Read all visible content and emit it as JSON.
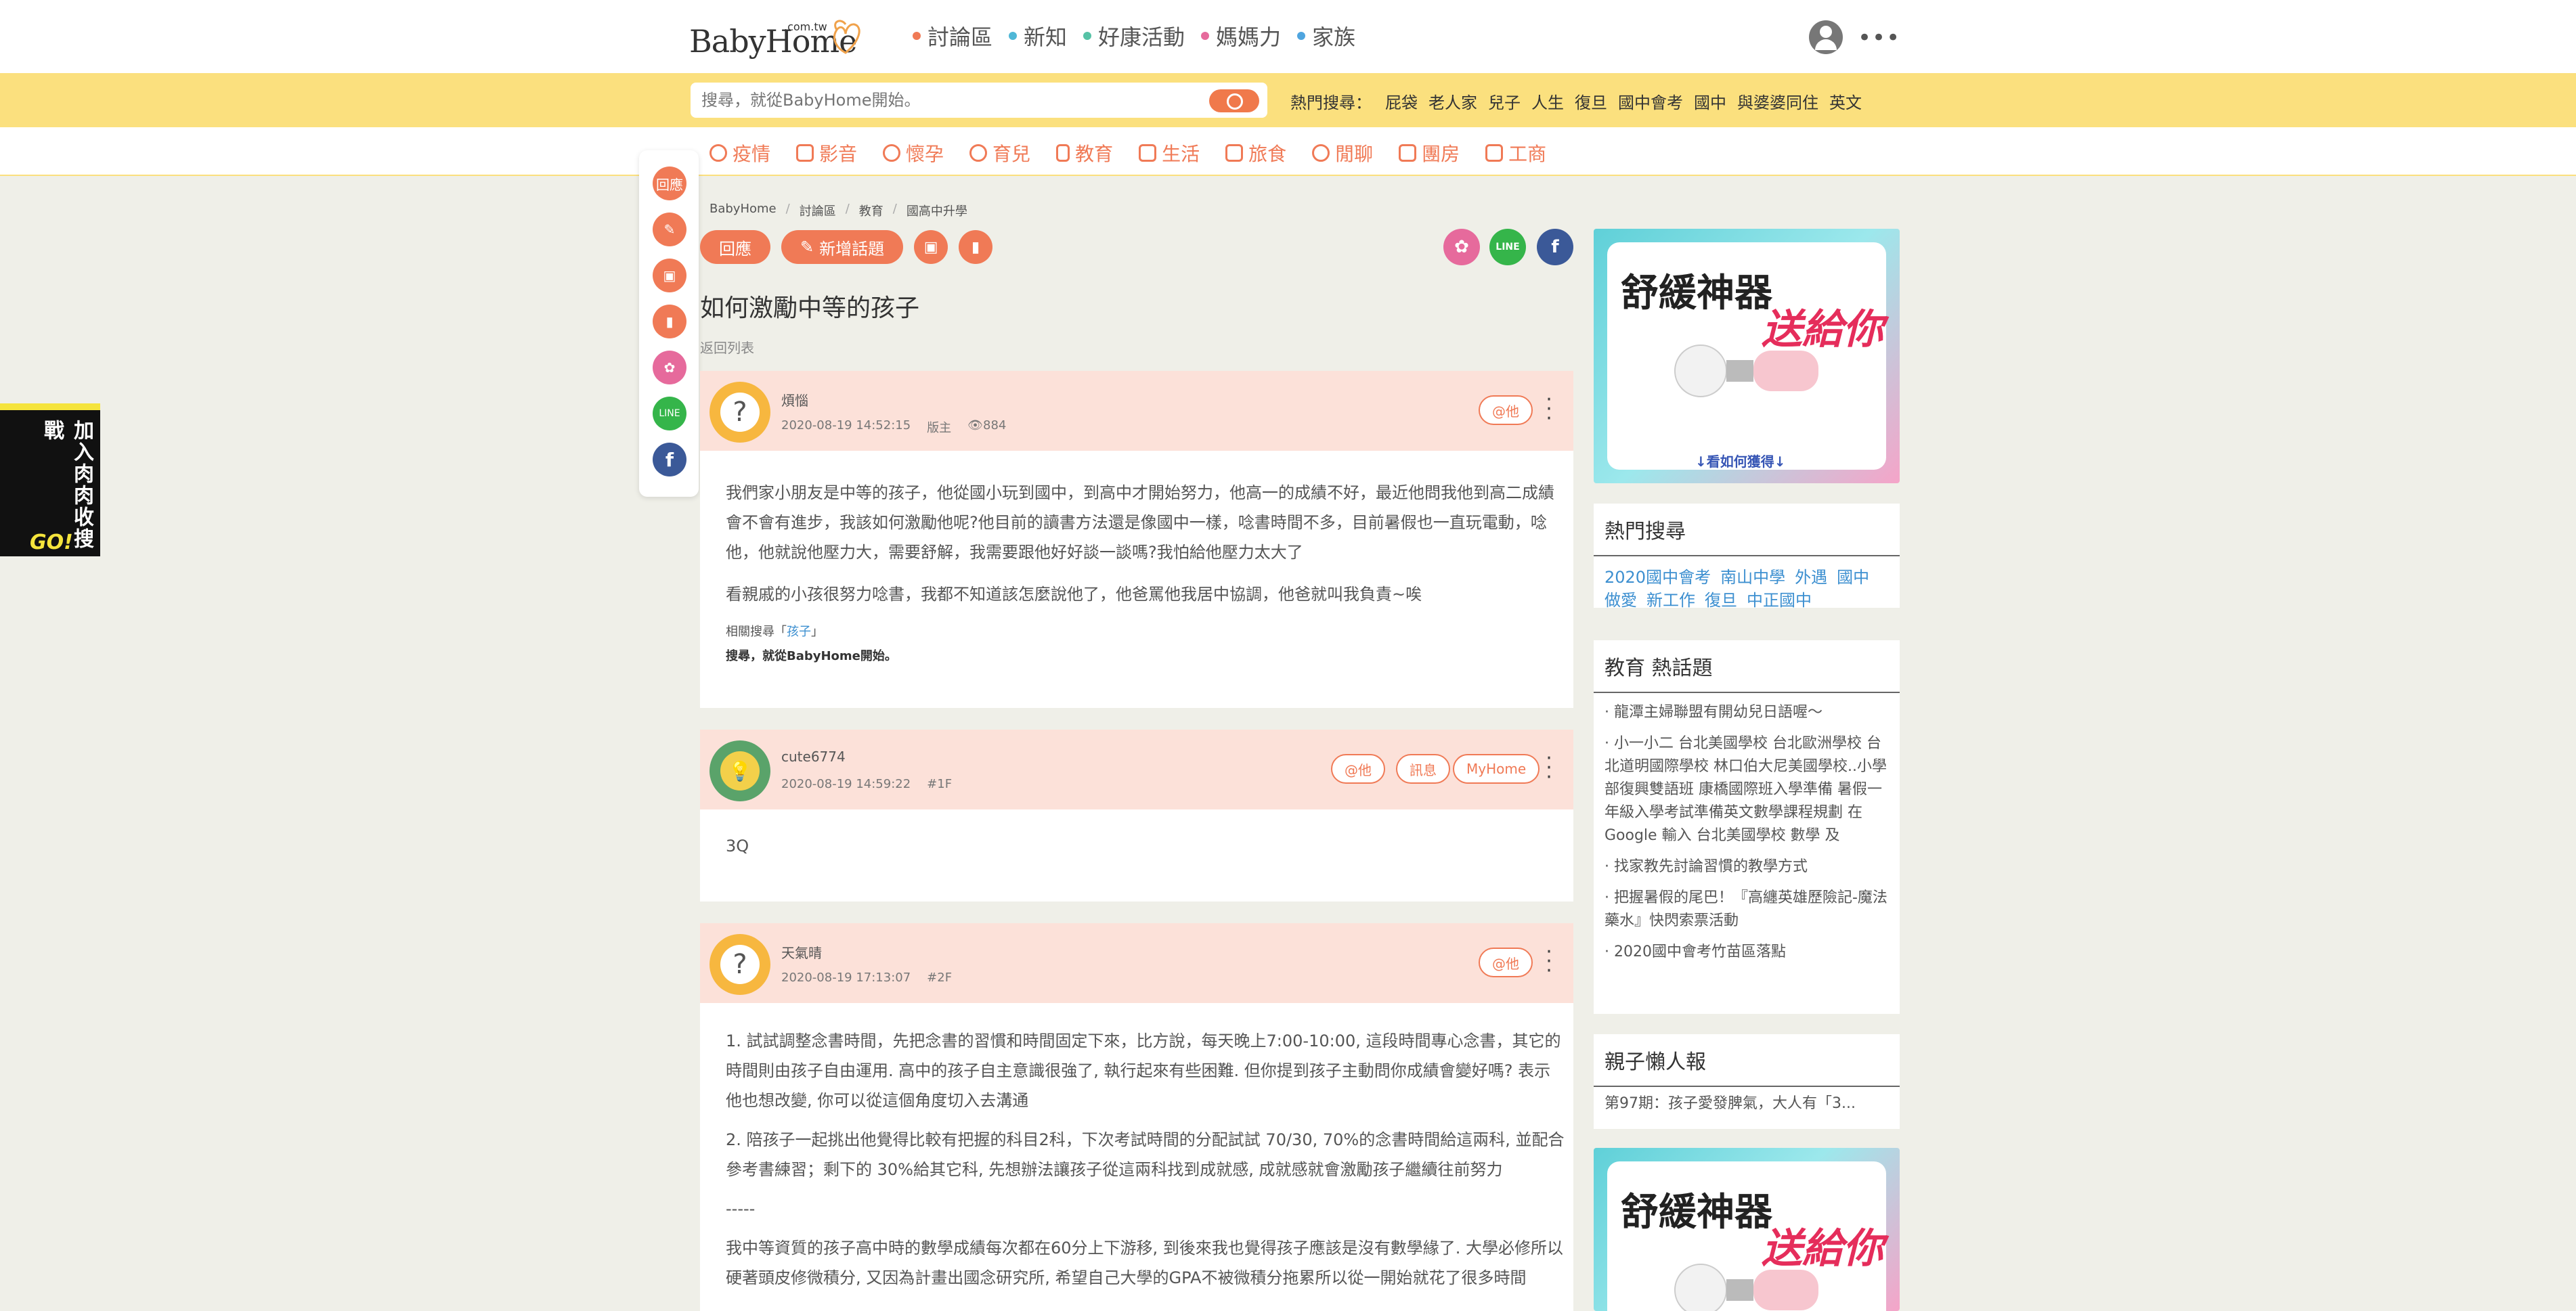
{
  "header": {
    "logo_text": "BabyHome",
    "logo_domain": ".com.tw",
    "nav": [
      {
        "label": "討論區",
        "color": "#f07a56"
      },
      {
        "label": "新知",
        "color": "#4fb7d6"
      },
      {
        "label": "好康活動",
        "color": "#56c2a6"
      },
      {
        "label": "媽媽力",
        "color": "#e66a9c"
      },
      {
        "label": "家族",
        "color": "#4fa5df"
      }
    ],
    "more": "•••"
  },
  "search": {
    "placeholder": "搜尋，就從BabyHome開始。",
    "hot_label": "熱門搜尋：",
    "hot_terms": [
      "屁袋",
      "老人家",
      "兒子",
      "人生",
      "復旦",
      "國中會考",
      "國中",
      "與婆婆同住",
      "英文"
    ]
  },
  "categories": [
    "疫情",
    "影音",
    "懷孕",
    "育兒",
    "教育",
    "生活",
    "旅食",
    "閒聊",
    "團房",
    "工商"
  ],
  "float_toolbar": {
    "reply": "回應",
    "colors": {
      "orange": "#f07a56",
      "pink": "#e66a9c",
      "green": "#35b54a",
      "blue": "#3b5998"
    }
  },
  "left_ad": {
    "text": "加入肉肉收搜戰",
    "go": "GO!"
  },
  "breadcrumb": [
    "BabyHome",
    "討論區",
    "教育",
    "國高中升學"
  ],
  "actions": {
    "reply": "回應",
    "new_topic": "新增話題"
  },
  "title": "如何激勵中等的孩子",
  "back_to_list": "返回列表",
  "posts": [
    {
      "user": "煩惱",
      "time": "2020-08-19 14:52:15",
      "role": "版主",
      "views": "884",
      "tags": [
        "@他"
      ],
      "paragraphs": [
        "我們家小朋友是中等的孩子，他從國小玩到國中，到高中才開始努力，他高一的成績不好，最近他問我他到高二成績會不會有進步，我該如何激勵他呢?他目前的讀書方法還是像國中一樣，唸書時間不多，目前暑假也一直玩電動，唸他，他就說他壓力大，需要舒解，我需要跟他好好談一談嗎?我怕給他壓力太大了",
        "看親戚的小孩很努力唸書，我都不知道該怎麼說他了，他爸罵他我居中協調，他爸就叫我負責~唉"
      ],
      "related_label": "相關搜尋「",
      "related_term": "孩子",
      "related_end": "」",
      "slogan": "搜尋，就從BabyHome開始。"
    },
    {
      "user": "cute6774",
      "time": "2020-08-19 14:59:22",
      "floor": "#1F",
      "tags": [
        "@他",
        "訊息",
        "MyHome"
      ],
      "paragraphs": [
        "3Q"
      ]
    },
    {
      "user": "天氣晴",
      "time": "2020-08-19 17:13:07",
      "floor": "#2F",
      "tags": [
        "@他"
      ],
      "paragraphs": [
        "1. 試試調整念書時間，先把念書的習慣和時間固定下來，比方說，每天晚上7:00-10:00, 這段時間專心念書，其它的時間則由孩子自由運用. 高中的孩子自主意識很強了, 執行起來有些困難. 但你提到孩子主動問你成績會變好嗎? 表示他也想改變, 你可以從這個角度切入去溝通",
        "2. 陪孩子一起挑出他覺得比較有把握的科目2科，下次考試時間的分配試試 70/30, 70%的念書時間給這兩科, 並配合參考書練習；剩下的 30%給其它科, 先想辦法讓孩子從這兩科找到成就感, 成就感就會激勵孩子繼續往前努力",
        "-----",
        "我中等資質的孩子高中時的數學成績每次都在60分上下游移, 到後來我也覺得孩子應該是沒有數學緣了. 大學必修所以硬著頭皮修微積分, 又因為計畫出國念研究所, 希望自己大學的GPA不被微積分拖累所以從一開始就花了很多時間"
      ]
    }
  ],
  "sidebar": {
    "ad_title": "舒緩神器",
    "ad_title2": "送給你",
    "ad_foot": "↓看如何獲得↓",
    "hot_search_title": "熱門搜尋",
    "hot_search": [
      "2020國中會考",
      "南山中學",
      "外遇",
      "國中",
      "做愛",
      "新工作",
      "復旦",
      "中正國中"
    ],
    "edu_title": "教育 熱話題",
    "edu_topics": [
      "· 龍潭主婦聯盟有開幼兒日語喔～",
      "· 小一小二 台北美國學校 台北歐洲學校 台北道明國際學校 林口伯大尼美國學校..小學部復興雙語班 康橋國際班入學準備 暑假一年級入學考試準備英文數學課程規劃 在Google 輸入 台北美國學校 數學 及",
      "· 找家教先討論習慣的教學方式",
      "· 把握暑假的尾巴！『高纏英雄歷險記-魔法藥水』快閃索票活動",
      "· 2020國中會考竹苗區落點"
    ],
    "newsletter_title": "親子懶人報",
    "newsletter_item": "第97期：孩子愛發脾氣，大人有「3..."
  }
}
